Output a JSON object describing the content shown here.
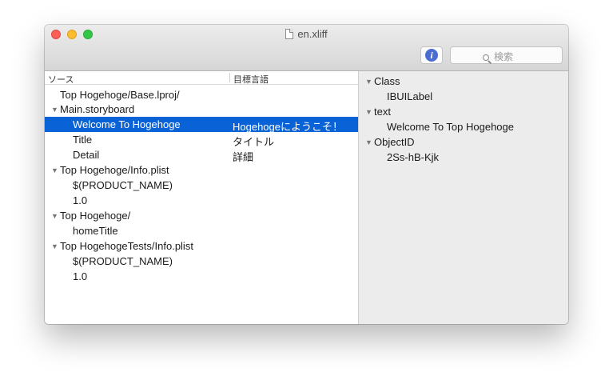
{
  "window": {
    "title": "en.xliff",
    "search_placeholder": "検索",
    "info_glyph": "i"
  },
  "table": {
    "headers": [
      "ソース",
      "目標言語"
    ],
    "rows": [
      {
        "type": "group",
        "lines": [
          "Top Hogehoge/Base.lproj/",
          "Main.storyboard"
        ]
      },
      {
        "type": "item",
        "source": "Welcome To Hogehoge",
        "target": "Hogehogeにようこそ！",
        "selected": true
      },
      {
        "type": "item",
        "source": "Title",
        "target": "タイトル"
      },
      {
        "type": "item",
        "source": "Detail",
        "target": "詳細"
      },
      {
        "type": "group",
        "lines": [
          "Top Hogehoge/Info.plist"
        ]
      },
      {
        "type": "item",
        "source": "$(PRODUCT_NAME)",
        "target": ""
      },
      {
        "type": "item",
        "source": "1.0",
        "target": ""
      },
      {
        "type": "group",
        "lines": [
          "Top Hogehoge/"
        ]
      },
      {
        "type": "item",
        "source": "homeTitle",
        "target": ""
      },
      {
        "type": "group",
        "lines": [
          "Top HogehogeTests/Info.plist"
        ]
      },
      {
        "type": "item",
        "source": "$(PRODUCT_NAME)",
        "target": ""
      },
      {
        "type": "item",
        "source": "1.0",
        "target": ""
      }
    ]
  },
  "inspector": [
    {
      "label": "Class",
      "value": "IBUILabel"
    },
    {
      "label": "text",
      "value": "Welcome To Top Hogehoge"
    },
    {
      "label": "ObjectID",
      "value": "2Ss-hB-Kjk"
    }
  ],
  "colors": {
    "selection": "#0a63d6",
    "info_button": "#4a6cd3",
    "close": "#fc5f57",
    "minimize": "#fdbc2e",
    "maximize": "#33c748"
  },
  "icons": {
    "disclosure": "▼",
    "document": "document-icon",
    "search": "search-icon",
    "info": "info-icon"
  }
}
